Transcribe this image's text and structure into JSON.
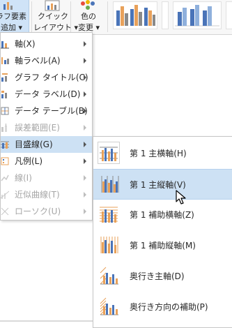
{
  "ribbon": {
    "add_element": {
      "line1": "ラフ要素",
      "line2": "追加 ▾"
    },
    "quick_layout": {
      "line1": "クイック",
      "line2": "レイアウト ▾"
    },
    "change_colors": {
      "line1": "色の",
      "line2": "変更 ▾"
    }
  },
  "menu": {
    "items": [
      {
        "label": "軸(X)",
        "icon": "axes-icon",
        "disabled": false,
        "active": false
      },
      {
        "label": "軸ラベル(A)",
        "icon": "axis-titles-icon",
        "disabled": false,
        "active": false
      },
      {
        "label": "グラフ タイトル(C)",
        "icon": "chart-title-icon",
        "disabled": false,
        "active": false
      },
      {
        "label": "データ ラベル(D)",
        "icon": "data-labels-icon",
        "disabled": false,
        "active": false
      },
      {
        "label": "データ テーブル(B)",
        "icon": "data-table-icon",
        "disabled": false,
        "active": false
      },
      {
        "label": "誤差範囲(E)",
        "icon": "error-bars-icon",
        "disabled": true,
        "active": false
      },
      {
        "label": "目盛線(G)",
        "icon": "gridlines-icon",
        "disabled": false,
        "active": true
      },
      {
        "label": "凡例(L)",
        "icon": "legend-icon",
        "disabled": false,
        "active": false
      },
      {
        "label": "線(I)",
        "icon": "lines-icon",
        "disabled": true,
        "active": false
      },
      {
        "label": "近似曲線(T)",
        "icon": "trendline-icon",
        "disabled": true,
        "active": false
      },
      {
        "label": "ローソク(U)",
        "icon": "up-down-bars-icon",
        "disabled": true,
        "active": false
      }
    ]
  },
  "submenu": {
    "items": [
      {
        "label": "第 1 主横軸(H)",
        "icon": "primary-major-horizontal-icon"
      },
      {
        "label": "第 1 主縦軸(V)",
        "icon": "primary-major-vertical-icon"
      },
      {
        "label": "第 1 補助横軸(Z)",
        "icon": "primary-minor-horizontal-icon"
      },
      {
        "label": "第 1 補助縦軸(M)",
        "icon": "primary-minor-vertical-icon"
      },
      {
        "label": "奥行き主軸(D)",
        "icon": "depth-major-icon"
      },
      {
        "label": "奥行き方向の補助(P)",
        "icon": "depth-minor-icon"
      }
    ],
    "hovered_index": 1
  },
  "colors": {
    "menu_active_bg": "#cde1f4",
    "bar_orange": "#e8a15a",
    "bar_blue": "#4a74b8",
    "bar_gray": "#8a8a8a",
    "grid_line": "#bfbfbf"
  }
}
